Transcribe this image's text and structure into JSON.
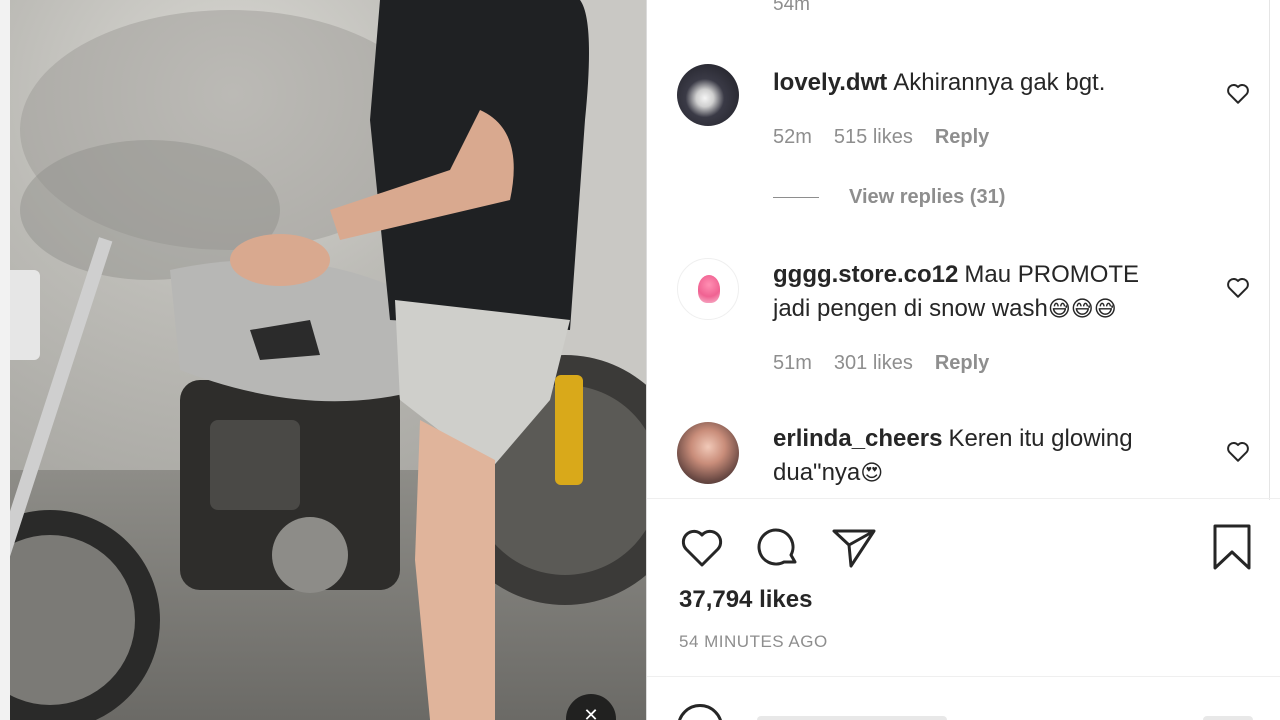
{
  "top_comment": {
    "time": "54m"
  },
  "comments": [
    {
      "username": "lovely.dwt",
      "text": "Akhirannya gak bgt.",
      "time": "52m",
      "likes": "515 likes",
      "reply": "Reply"
    },
    {
      "username": "gggg.store.co12",
      "text": "Mau PROMOTE jadi pengen di snow wash",
      "emoji": "😅😅😅",
      "time": "51m",
      "likes": "301 likes",
      "reply": "Reply"
    },
    {
      "username": "erlinda_cheers",
      "text": "Keren itu glowing dua\"nya",
      "emoji": "😍"
    }
  ],
  "view_replies": "View replies (31)",
  "post": {
    "likes": "37,794 likes",
    "time_ago": "54 MINUTES AGO"
  },
  "icons": {
    "like": "heart-icon",
    "comment": "comment-bubble-icon",
    "share": "send-icon",
    "save": "bookmark-icon",
    "sound": "sound-off-icon"
  }
}
